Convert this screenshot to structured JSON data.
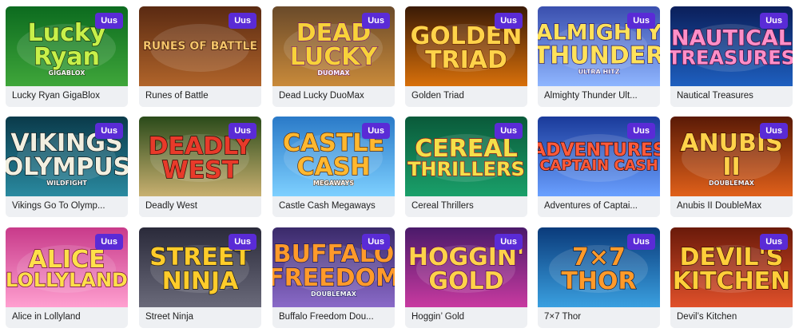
{
  "badge_label": "Uus",
  "games": [
    {
      "title": "Lucky Ryan GigaBlox",
      "caption": "Lucky Ryan GigaBlox",
      "logo_lines": [
        "Lucky",
        "Ryan"
      ],
      "logo_sub": "GIGABLOX",
      "bg1": "#0c6b1f",
      "bg2": "#3fa63a",
      "logo_color": "#c8f04a",
      "stroke": "#1d3a0a"
    },
    {
      "title": "Runes of Battle",
      "caption": "Runes of Battle",
      "logo_lines": [
        "RUNES OF BATTLE"
      ],
      "logo_sub": "",
      "bg1": "#5a2a12",
      "bg2": "#b0642a",
      "logo_color": "#f4c46a",
      "stroke": "#3a1608"
    },
    {
      "title": "Dead Lucky DuoMax",
      "caption": "Dead Lucky DuoMax",
      "logo_lines": [
        "DEAD",
        "LUCKY"
      ],
      "logo_sub": "DUOMAX",
      "bg1": "#6a4a2a",
      "bg2": "#c98a3a",
      "logo_color": "#f7d23a",
      "stroke": "#7a1f6a"
    },
    {
      "title": "Golden Triad",
      "caption": "Golden Triad",
      "logo_lines": [
        "GOLDEN",
        "TRIAD"
      ],
      "logo_sub": "",
      "bg1": "#3a1a06",
      "bg2": "#d8700a",
      "logo_color": "#ffd34a",
      "stroke": "#6a2a04"
    },
    {
      "title": "Almighty Thunder UltraHitz",
      "caption": "Almighty Thunder Ult...",
      "logo_lines": [
        "ALMIGHTY",
        "THUNDER"
      ],
      "logo_sub": "ULTRA HITZ",
      "bg1": "#3a4fae",
      "bg2": "#8fb6ff",
      "logo_color": "#ffe25a",
      "stroke": "#2a1a6a"
    },
    {
      "title": "Nautical Treasures",
      "caption": "Nautical Treasures",
      "logo_lines": [
        "NAUTICAL",
        "TREASURES"
      ],
      "logo_sub": "",
      "bg1": "#0b1f5a",
      "bg2": "#1e5fbf",
      "logo_color": "#ff8fc8",
      "stroke": "#4a0a3a"
    },
    {
      "title": "Vikings Go To Olympus",
      "caption": "Vikings Go To Olymp...",
      "logo_lines": [
        "VIKINGS",
        "OLYMPUS"
      ],
      "logo_sub": "WILDFIGHT",
      "bg1": "#0a3a4a",
      "bg2": "#2a8aa0",
      "logo_color": "#f2efe0",
      "stroke": "#0a1a20"
    },
    {
      "title": "Deadly West",
      "caption": "Deadly West",
      "logo_lines": [
        "DEADLY",
        "WEST"
      ],
      "logo_sub": "",
      "bg1": "#2a4a1a",
      "bg2": "#c8b070",
      "logo_color": "#e83a2a",
      "stroke": "#2a0a04"
    },
    {
      "title": "Castle Cash Megaways",
      "caption": "Castle Cash Megaways",
      "logo_lines": [
        "CASTLE",
        "CASH"
      ],
      "logo_sub": "MEGAWAYS",
      "bg1": "#2a7ac8",
      "bg2": "#7ed0ff",
      "logo_color": "#ffb830",
      "stroke": "#5a2a04"
    },
    {
      "title": "Cereal Thrillers",
      "caption": "Cereal Thrillers",
      "logo_lines": [
        "CEREAL",
        "THRILLERS"
      ],
      "logo_sub": "",
      "bg1": "#0a5a3a",
      "bg2": "#1aa06a",
      "logo_color": "#f4e04a",
      "stroke": "#a01a1a"
    },
    {
      "title": "Adventures of Captain Cash",
      "caption": "Adventures of Captai...",
      "logo_lines": [
        "ADVENTURES",
        "CAPTAIN CASH"
      ],
      "logo_sub": "",
      "bg1": "#1a3a9a",
      "bg2": "#6aa0ff",
      "logo_color": "#ff5a3a",
      "stroke": "#3a0a0a"
    },
    {
      "title": "Anubis II DoubleMax",
      "caption": "Anubis II DoubleMax",
      "logo_lines": [
        "ANUBIS",
        "II"
      ],
      "logo_sub": "DOUBLEMAX",
      "bg1": "#5a1a06",
      "bg2": "#e0601a",
      "logo_color": "#ffd24a",
      "stroke": "#3a0a02"
    },
    {
      "title": "Alice in Lollyland",
      "caption": "Alice in Lollyland",
      "logo_lines": [
        "ALICE",
        "LOLLYLAND"
      ],
      "logo_sub": "",
      "bg1": "#c83a8a",
      "bg2": "#ffa0d0",
      "logo_color": "#ffe04a",
      "stroke": "#6a0a3a"
    },
    {
      "title": "Street Ninja",
      "caption": "Street Ninja",
      "logo_lines": [
        "STREET",
        "NINJA"
      ],
      "logo_sub": "",
      "bg1": "#2a2a3a",
      "bg2": "#6a6a7a",
      "logo_color": "#ffcc2a",
      "stroke": "#1a1a1a"
    },
    {
      "title": "Buffalo Freedom DoubleMax",
      "caption": "Buffalo Freedom Dou...",
      "logo_lines": [
        "BUFFALO",
        "FREEDOM"
      ],
      "logo_sub": "DOUBLEMAX",
      "bg1": "#3a2a6a",
      "bg2": "#8a6ac8",
      "logo_color": "#ff9a2a",
      "stroke": "#1a1a5a"
    },
    {
      "title": "Hoggin' Gold",
      "caption": "Hoggin’ Gold",
      "logo_lines": [
        "HOGGIN'",
        "GOLD"
      ],
      "logo_sub": "",
      "bg1": "#4a1a6a",
      "bg2": "#c83aa0",
      "logo_color": "#ffd24a",
      "stroke": "#5a0a5a"
    },
    {
      "title": "7×7 Thor",
      "caption": "7×7 Thor",
      "logo_lines": [
        "7×7",
        "THOR"
      ],
      "logo_sub": "",
      "bg1": "#0a3a7a",
      "bg2": "#3aa0e0",
      "logo_color": "#ff9a2a",
      "stroke": "#0a1a3a"
    },
    {
      "title": "Devil's Kitchen",
      "caption": "Devil’s Kitchen",
      "logo_lines": [
        "DEVIL'S",
        "KITCHEN"
      ],
      "logo_sub": "",
      "bg1": "#6a1a0a",
      "bg2": "#e0502a",
      "logo_color": "#ffcf3a",
      "stroke": "#3a0a04"
    }
  ]
}
